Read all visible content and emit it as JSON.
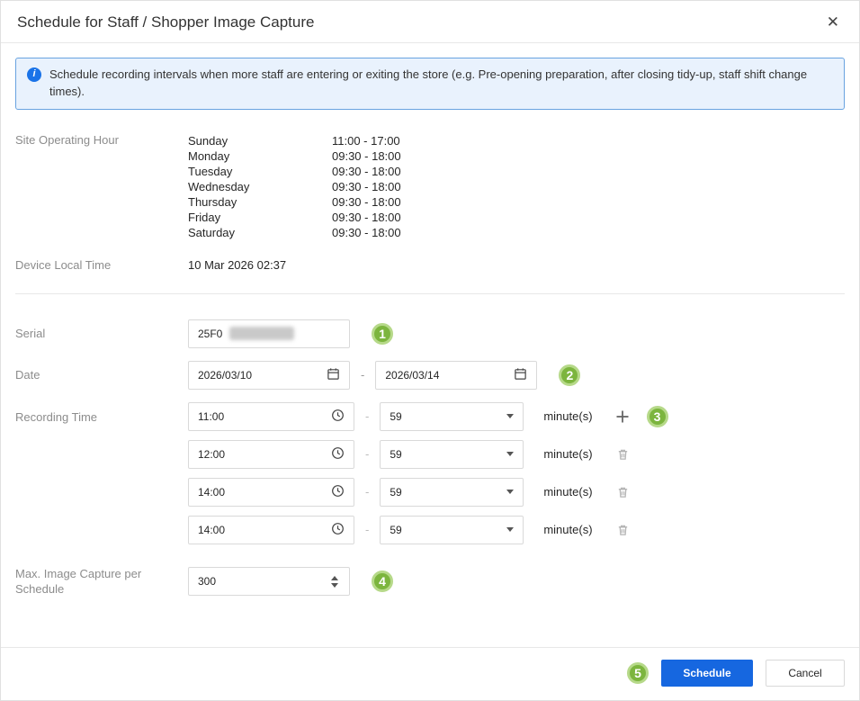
{
  "dialog": {
    "title": "Schedule for Staff / Shopper Image Capture",
    "close": "✕"
  },
  "banner": {
    "icon": "i",
    "text": "Schedule recording intervals when more staff are entering or exiting the store (e.g. Pre-opening preparation, after closing tidy-up, staff shift change times)."
  },
  "operating_hours": {
    "label": "Site Operating Hour",
    "rows": [
      {
        "day": "Sunday",
        "hours": "11:00 - 17:00"
      },
      {
        "day": "Monday",
        "hours": "09:30 - 18:00"
      },
      {
        "day": "Tuesday",
        "hours": "09:30 - 18:00"
      },
      {
        "day": "Wednesday",
        "hours": "09:30 - 18:00"
      },
      {
        "day": "Thursday",
        "hours": "09:30 - 18:00"
      },
      {
        "day": "Friday",
        "hours": "09:30 - 18:00"
      },
      {
        "day": "Saturday",
        "hours": "09:30 - 18:00"
      }
    ]
  },
  "device_local_time": {
    "label": "Device Local Time",
    "value": "10 Mar 2026 02:37"
  },
  "serial": {
    "label": "Serial",
    "value": "25F0",
    "badge": "1"
  },
  "date": {
    "label": "Date",
    "start": "2026/03/10",
    "end": "2026/03/14",
    "separator": "-",
    "badge": "2"
  },
  "recording": {
    "label": "Recording Time",
    "badge": "3",
    "separator": "-",
    "unit": "minute(s)",
    "rows": [
      {
        "start": "11:00",
        "duration": "59"
      },
      {
        "start": "12:00",
        "duration": "59"
      },
      {
        "start": "14:00",
        "duration": "59"
      },
      {
        "start": "14:00",
        "duration": "59"
      }
    ]
  },
  "max_capture": {
    "label": "Max. Image Capture per Schedule",
    "value": "300",
    "badge": "4"
  },
  "footer": {
    "badge": "5",
    "schedule": "Schedule",
    "cancel": "Cancel"
  },
  "colors": {
    "primary_blue": "#1667e0",
    "badge_green": "#7cb53e",
    "banner_bg": "#e9f2fd",
    "banner_border": "#69a3e0"
  }
}
